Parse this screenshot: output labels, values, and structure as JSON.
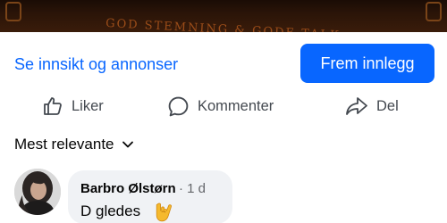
{
  "banner": {
    "decorative_text": "GOD STEMNING & GODE TALK"
  },
  "actions": {
    "insight_link": "Se innsikt og annonser",
    "new_post_button": "Frem innlegg"
  },
  "reactions": {
    "like_label": "Liker",
    "comment_label": "Kommenter",
    "share_label": "Del"
  },
  "sort": {
    "label": "Mest relevante"
  },
  "comment": {
    "author": "Barbro Ølstørn",
    "separator": "·",
    "time": "1 d",
    "text": "D gledes",
    "emoji": "rock-on-hand"
  },
  "colors": {
    "accent": "#0866ff",
    "bubble": "#f0f2f5",
    "muted": "#65676b"
  }
}
